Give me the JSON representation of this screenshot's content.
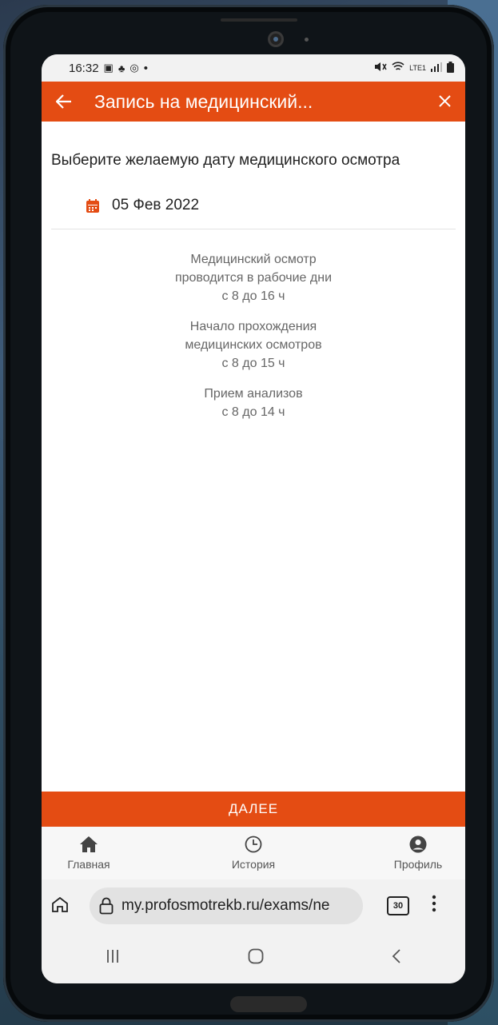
{
  "status": {
    "time": "16:32",
    "left_icons": [
      "image-icon",
      "notification-icon",
      "app-icon"
    ],
    "dot": "•",
    "network": "LTE1"
  },
  "appbar": {
    "title": "Запись на медицинский..."
  },
  "main": {
    "prompt": "Выберите желаемую дату медицинского осмотра",
    "selected_date": "05 Фев 2022",
    "info": [
      [
        "Медицинский осмотр",
        "проводится в рабочие дни",
        "с 8 до 16 ч"
      ],
      [
        "Начало прохождения",
        "медицинских осмотров",
        "с 8 до 15 ч"
      ],
      [
        "Прием анализов",
        "с 8 до 14 ч"
      ]
    ]
  },
  "actions": {
    "next_label": "ДАЛЕЕ"
  },
  "tabbar": {
    "items": [
      {
        "label": "Главная",
        "icon": "home-icon"
      },
      {
        "label": "История",
        "icon": "clock-icon"
      },
      {
        "label": "Профиль",
        "icon": "user-icon"
      }
    ]
  },
  "browser": {
    "url": "my.profosmotrekb.ru/exams/ne",
    "tab_count": "30"
  },
  "colors": {
    "accent": "#e44c13"
  }
}
